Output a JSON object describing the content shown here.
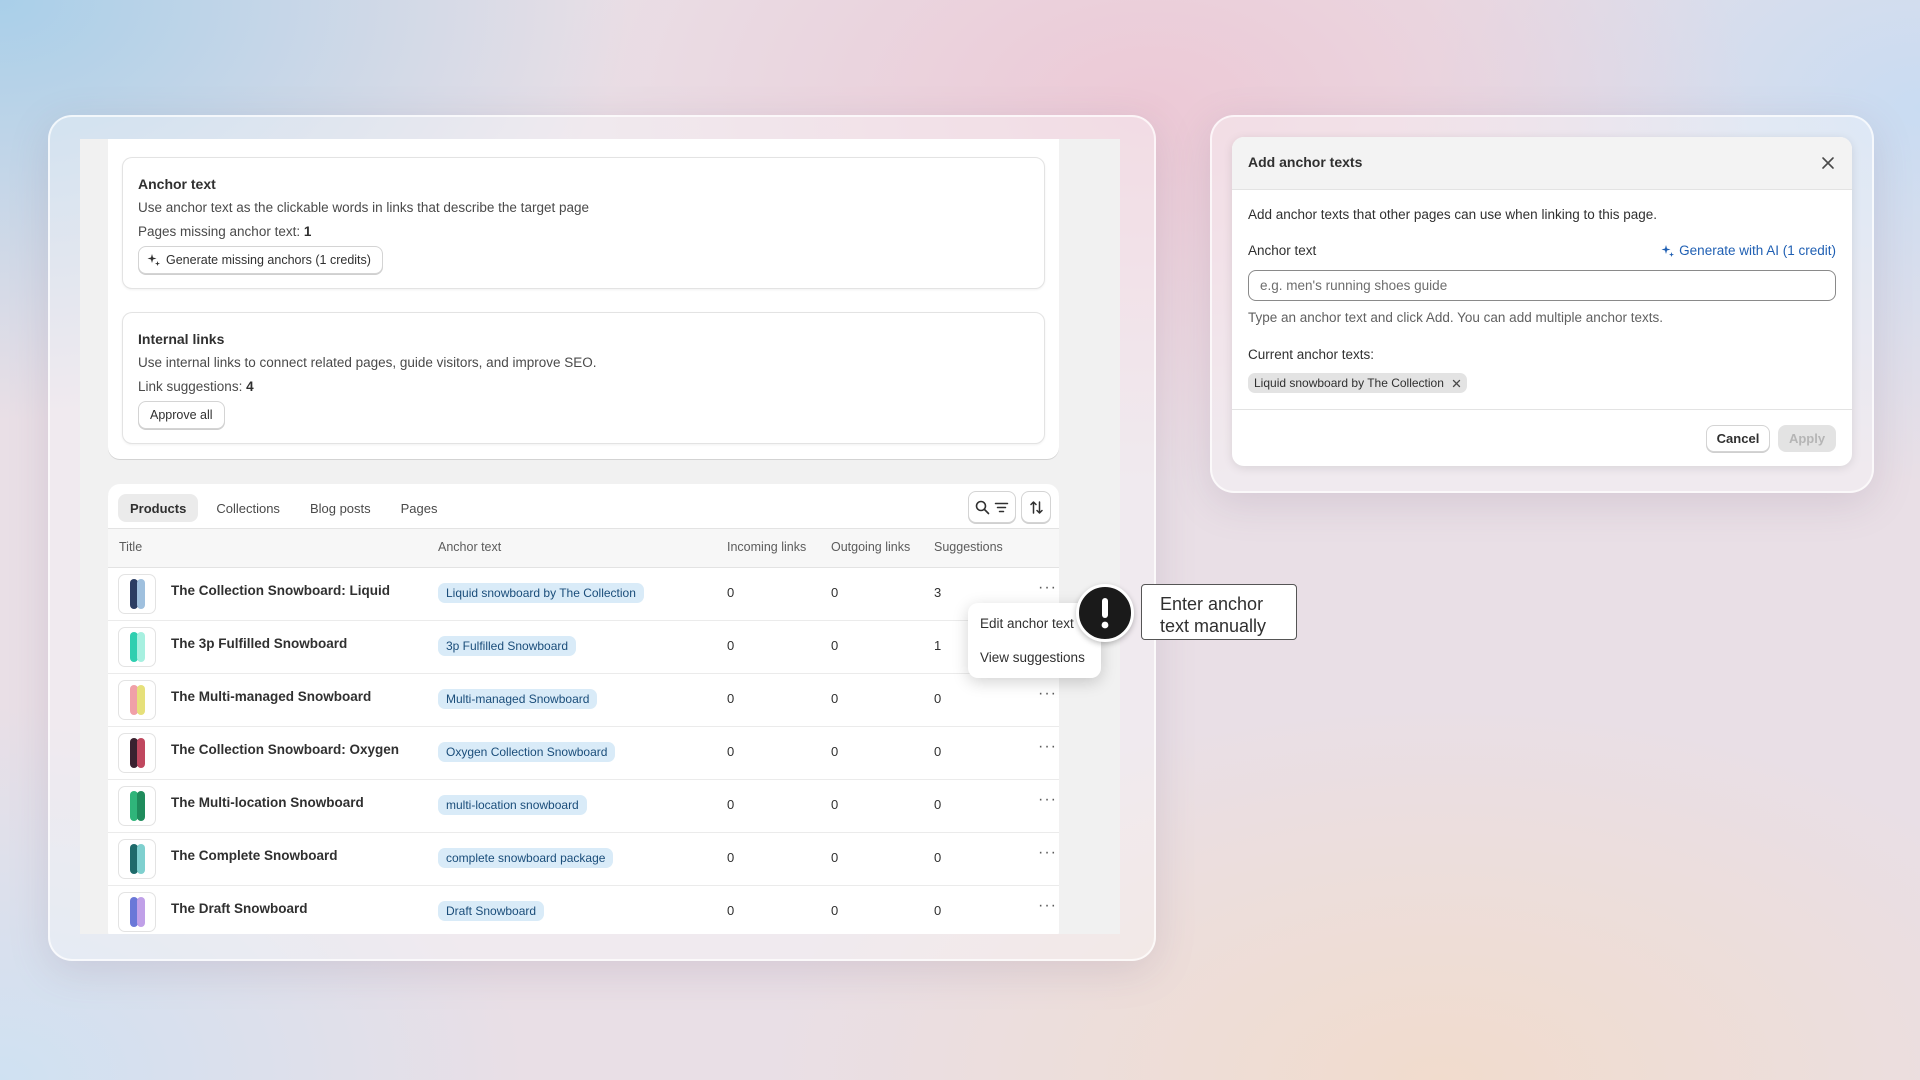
{
  "anchor_section": {
    "title": "Anchor text",
    "description": "Use anchor text as the clickable words in links that describe the target page",
    "missing_label": "Pages missing anchor text:",
    "missing_count": "1",
    "generate_button": "Generate missing anchors (1 credits)"
  },
  "links_section": {
    "title": "Internal links",
    "description": "Use internal links to connect related pages, guide visitors, and improve SEO.",
    "suggestions_label": "Link suggestions:",
    "suggestions_count": "4",
    "approve_button": "Approve all"
  },
  "tabs": [
    "Products",
    "Collections",
    "Blog posts",
    "Pages"
  ],
  "table": {
    "columns": [
      "Title",
      "Anchor text",
      "Incoming links",
      "Outgoing links",
      "Suggestions"
    ],
    "rows": [
      {
        "title": "The Collection Snowboard: Liquid",
        "anchor": "Liquid snowboard by The Collection",
        "incoming": "0",
        "outgoing": "0",
        "suggestions": "3",
        "colors": [
          "#2b3d63",
          "#9fc0de"
        ]
      },
      {
        "title": "The 3p Fulfilled Snowboard",
        "anchor": "3p Fulfilled Snowboard",
        "incoming": "0",
        "outgoing": "0",
        "suggestions": "1",
        "colors": [
          "#2fcfb0",
          "#a7f0e0"
        ]
      },
      {
        "title": "The Multi-managed Snowboard",
        "anchor": "Multi-managed Snowboard",
        "incoming": "0",
        "outgoing": "0",
        "suggestions": "0",
        "colors": [
          "#f0a0a8",
          "#e6e07a"
        ]
      },
      {
        "title": "The Collection Snowboard: Oxygen",
        "anchor": "Oxygen Collection Snowboard",
        "incoming": "0",
        "outgoing": "0",
        "suggestions": "0",
        "colors": [
          "#3a2230",
          "#c0485f"
        ]
      },
      {
        "title": "The Multi-location Snowboard",
        "anchor": "multi-location snowboard",
        "incoming": "0",
        "outgoing": "0",
        "suggestions": "0",
        "colors": [
          "#2fb57a",
          "#1f8c5c"
        ]
      },
      {
        "title": "The Complete Snowboard",
        "anchor": "complete snowboard package",
        "incoming": "0",
        "outgoing": "0",
        "suggestions": "0",
        "colors": [
          "#1f6b6b",
          "#7fd0cf"
        ]
      },
      {
        "title": "The Draft Snowboard",
        "anchor": "Draft Snowboard",
        "incoming": "0",
        "outgoing": "0",
        "suggestions": "0",
        "colors": [
          "#6a78d8",
          "#c0a0e8"
        ]
      }
    ]
  },
  "row_menu": {
    "items": [
      "Edit anchor text",
      "View suggestions"
    ]
  },
  "callout": {
    "text": "Enter anchor text manually"
  },
  "modal": {
    "title": "Add anchor texts",
    "intro": "Add anchor texts that other pages can use when linking to this page.",
    "field_label": "Anchor text",
    "generate_link": "Generate with AI (1 credit)",
    "input_value": "",
    "input_placeholder": "e.g. men's running shoes guide",
    "help": "Type an anchor text and click Add. You can add multiple anchor texts.",
    "current_label": "Current anchor texts:",
    "current_tags": [
      "Liquid snowboard by The Collection"
    ],
    "cancel": "Cancel",
    "apply": "Apply"
  },
  "colors": {
    "accent_blue": "#1f5fb3",
    "pill_bg": "#d9ebf8",
    "dark": "#1a1a1a"
  }
}
